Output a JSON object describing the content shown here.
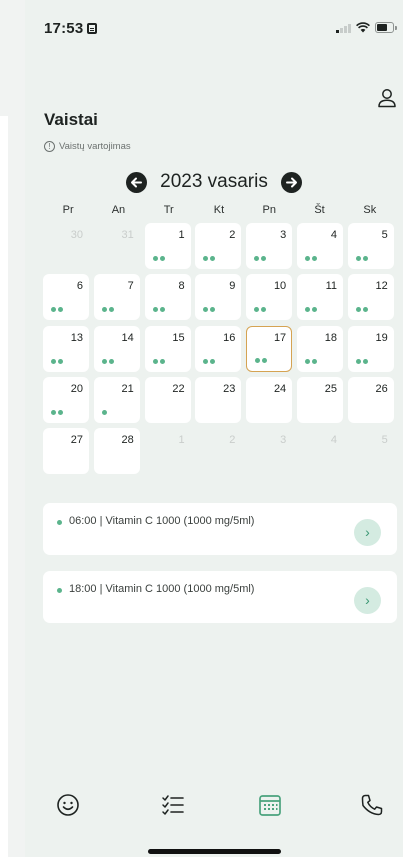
{
  "status_bar": {
    "time": "17:53"
  },
  "header": {
    "title": "Vaistai",
    "subtitle": "Vaistų vartojimas"
  },
  "calendar": {
    "month_label": "2023 vasaris",
    "weekdays": [
      "Pr",
      "An",
      "Tr",
      "Kt",
      "Pn",
      "Št",
      "Sk"
    ],
    "weeks": [
      [
        {
          "day": "30",
          "out": true,
          "dots": 0
        },
        {
          "day": "31",
          "out": true,
          "dots": 0
        },
        {
          "day": "1",
          "dots": 2
        },
        {
          "day": "2",
          "dots": 2
        },
        {
          "day": "3",
          "dots": 2
        },
        {
          "day": "4",
          "dots": 2
        },
        {
          "day": "5",
          "dots": 2
        }
      ],
      [
        {
          "day": "6",
          "dots": 2
        },
        {
          "day": "7",
          "dots": 2
        },
        {
          "day": "8",
          "dots": 2
        },
        {
          "day": "9",
          "dots": 2
        },
        {
          "day": "10",
          "dots": 2
        },
        {
          "day": "11",
          "dots": 2
        },
        {
          "day": "12",
          "dots": 2
        }
      ],
      [
        {
          "day": "13",
          "dots": 2
        },
        {
          "day": "14",
          "dots": 2
        },
        {
          "day": "15",
          "dots": 2
        },
        {
          "day": "16",
          "dots": 2
        },
        {
          "day": "17",
          "dots": 2,
          "today": true
        },
        {
          "day": "18",
          "dots": 2
        },
        {
          "day": "19",
          "dots": 2
        }
      ],
      [
        {
          "day": "20",
          "dots": 2
        },
        {
          "day": "21",
          "dots": 1
        },
        {
          "day": "22",
          "dots": 0
        },
        {
          "day": "23",
          "dots": 0
        },
        {
          "day": "24",
          "dots": 0
        },
        {
          "day": "25",
          "dots": 0
        },
        {
          "day": "26",
          "dots": 0
        }
      ],
      [
        {
          "day": "27",
          "dots": 0
        },
        {
          "day": "28",
          "dots": 0
        },
        {
          "day": "1",
          "out": true,
          "dots": 0
        },
        {
          "day": "2",
          "out": true,
          "dots": 0
        },
        {
          "day": "3",
          "out": true,
          "dots": 0
        },
        {
          "day": "4",
          "out": true,
          "dots": 0
        },
        {
          "day": "5",
          "out": true,
          "dots": 0
        }
      ]
    ]
  },
  "doses": [
    {
      "label": "06:00 | Vitamin C 1000 (1000 mg/5ml)"
    },
    {
      "label": "18:00 | Vitamin C 1000 (1000 mg/5ml)"
    }
  ],
  "tabbar": {
    "items": [
      {
        "icon": "smiley-icon"
      },
      {
        "icon": "checklist-icon"
      },
      {
        "icon": "calendar-icon",
        "active": true
      },
      {
        "icon": "phone-icon"
      }
    ]
  },
  "colors": {
    "accent": "#5bb48c",
    "today_border": "#d5a352",
    "background": "#edf2ef",
    "active_tab": "#4aa37d"
  }
}
